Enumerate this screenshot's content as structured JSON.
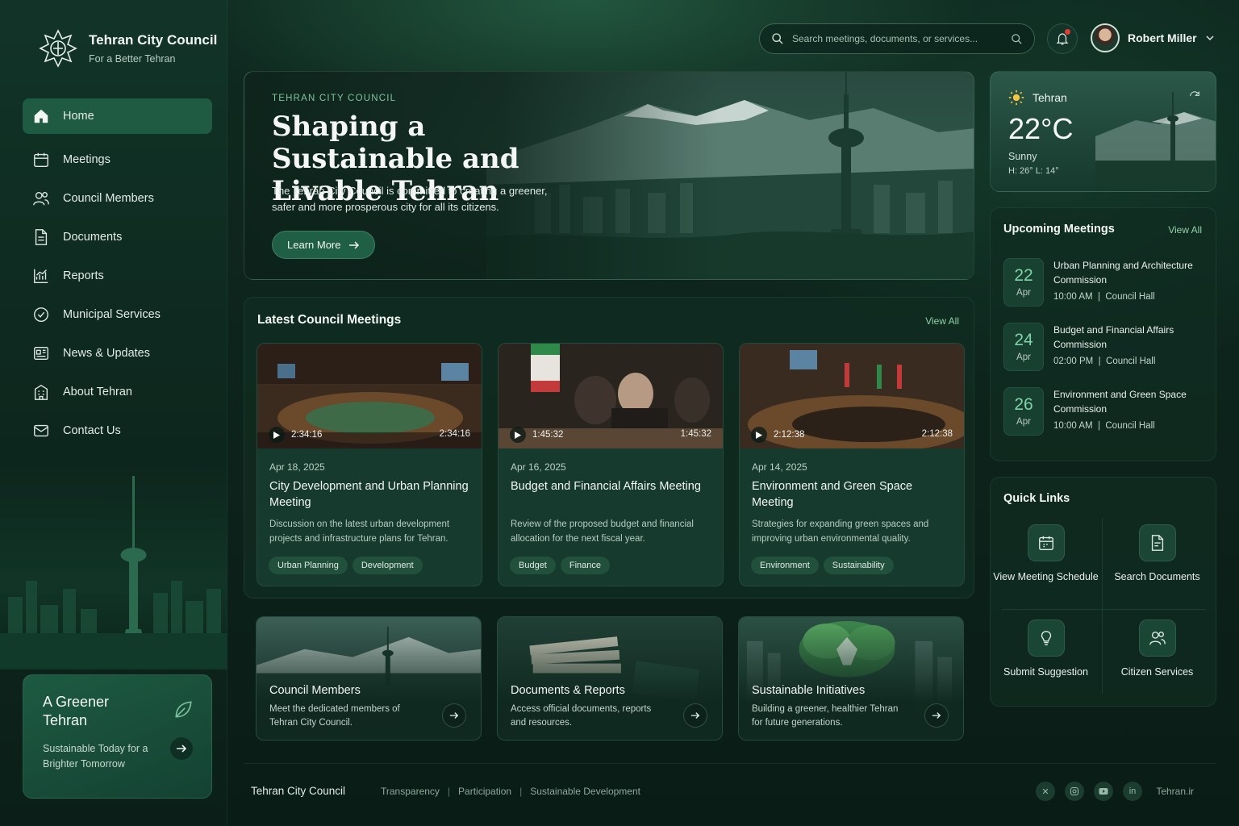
{
  "brand": {
    "title": "Tehran City Council",
    "subtitle": "For a Better Tehran"
  },
  "nav": {
    "items": [
      {
        "label": "Home",
        "icon": "home-icon",
        "active": true
      },
      {
        "label": "Meetings",
        "icon": "calendar-icon"
      },
      {
        "label": "Council Members",
        "icon": "users-icon"
      },
      {
        "label": "Documents",
        "icon": "document-icon"
      },
      {
        "label": "Reports",
        "icon": "chart-icon"
      },
      {
        "label": "Municipal Services",
        "icon": "services-icon"
      },
      {
        "label": "News & Updates",
        "icon": "news-icon"
      },
      {
        "label": "About Tehran",
        "icon": "building-icon"
      },
      {
        "label": "Contact Us",
        "icon": "mail-icon"
      }
    ]
  },
  "greener": {
    "title": "A Greener Tehran",
    "subtitle": "Sustainable Today for a Brighter Tomorrow"
  },
  "search": {
    "placeholder": "Search meetings, documents, or services..."
  },
  "user": {
    "name": "Robert Miller"
  },
  "hero": {
    "kicker": "TEHRAN CITY COUNCIL",
    "title": "Shaping a Sustainable and Livable Tehran",
    "text": "The Tehran City Council is committed to creating a greener, safer and more prosperous city for all its citizens.",
    "button": "Learn More"
  },
  "latest": {
    "title": "Latest Council Meetings",
    "view_all": "View All",
    "cards": [
      {
        "duration": "2:34:16",
        "date": "Apr 18, 2025",
        "title": "City Development and Urban Planning Meeting",
        "desc": "Discussion on the latest urban development projects and infrastructure plans for Tehran.",
        "tags": [
          "Urban Planning",
          "Development"
        ]
      },
      {
        "duration": "1:45:32",
        "date": "Apr 16, 2025",
        "title": "Budget and Financial Affairs Meeting",
        "desc": "Review of the proposed budget and financial allocation for the next fiscal year.",
        "tags": [
          "Budget",
          "Finance"
        ]
      },
      {
        "duration": "2:12:38",
        "date": "Apr 14, 2025",
        "title": "Environment and Green Space Meeting",
        "desc": "Strategies for expanding green spaces and improving urban environmental quality.",
        "tags": [
          "Environment",
          "Sustainability"
        ]
      }
    ]
  },
  "features": [
    {
      "title": "Council Members",
      "desc": "Meet the dedicated members of Tehran City Council."
    },
    {
      "title": "Documents & Reports",
      "desc": "Access official documents, reports and resources."
    },
    {
      "title": "Sustainable Initiatives",
      "desc": "Building a greener, healthier Tehran for future generations."
    }
  ],
  "weather": {
    "city": "Tehran",
    "temp": "22°C",
    "condition": "Sunny",
    "hilo": "H: 26°   L: 14°"
  },
  "upcoming": {
    "title": "Upcoming Meetings",
    "view_all": "View All",
    "items": [
      {
        "day": "22",
        "month": "Apr",
        "title": "Urban Planning and Architecture Commission",
        "time": "10:00 AM",
        "place": "Council Hall"
      },
      {
        "day": "24",
        "month": "Apr",
        "title": "Budget and Financial Affairs Commission",
        "time": "02:00 PM",
        "place": "Council Hall"
      },
      {
        "day": "26",
        "month": "Apr",
        "title": "Environment and Green Space Commission",
        "time": "10:00 AM",
        "place": "Council Hall"
      }
    ]
  },
  "quick_links": {
    "title": "Quick Links",
    "items": [
      {
        "label": "View Meeting Schedule",
        "icon": "calendar-icon"
      },
      {
        "label": "Search Documents",
        "icon": "document-search-icon"
      },
      {
        "label": "Submit Suggestion",
        "icon": "lightbulb-icon"
      },
      {
        "label": "Citizen Services",
        "icon": "users-icon"
      }
    ]
  },
  "footer": {
    "brand": "Tehran City Council",
    "links": [
      "Transparency",
      "Participation",
      "Sustainable Development"
    ],
    "socials": [
      "x-icon",
      "instagram-icon",
      "youtube-icon",
      "linkedin-icon"
    ],
    "site": "Tehran.ir"
  },
  "colors": {
    "accent": "#1f5a43",
    "link": "#8fd1ab",
    "background": "#0b1f18",
    "notification": "#e53935"
  }
}
